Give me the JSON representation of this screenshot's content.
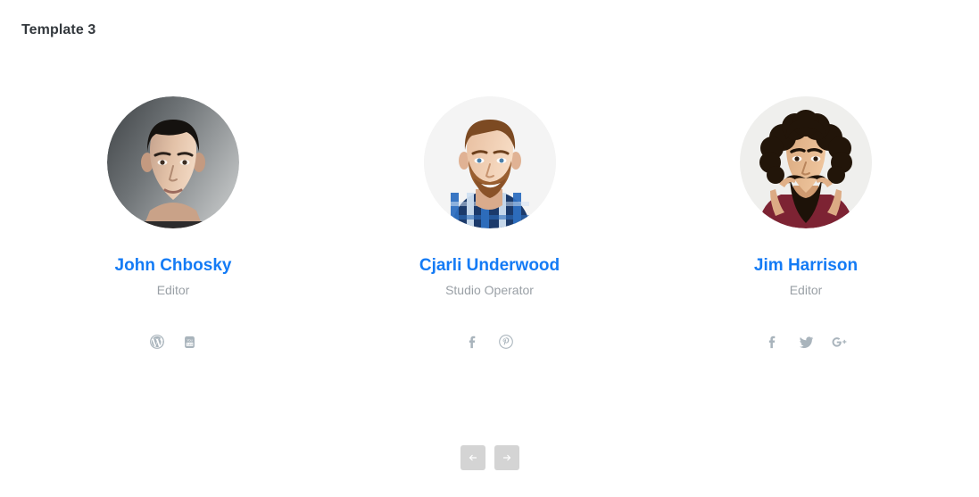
{
  "page": {
    "title": "Template 3",
    "background_color": "#ffffff"
  },
  "theme": {
    "name_color": "#147bf5",
    "role_color": "#9aa0a6",
    "social_icon_color": "#a9b4bc",
    "nav_button_color": "#d4d4d4",
    "nav_arrow_color": "#ffffff",
    "title_color": "#33383d"
  },
  "team": {
    "members": [
      {
        "name": "John Chbosky",
        "role": "Editor",
        "avatar_alt": "Portrait of a young man with short dark hair on a gray gradient background",
        "socials": [
          {
            "label": "WordPress",
            "icon": "wordpress-icon"
          },
          {
            "label": "YouTube",
            "icon": "youtube-icon"
          }
        ]
      },
      {
        "name": "Cjarli Underwood",
        "role": "Studio Operator",
        "avatar_alt": "Portrait of a smiling bearded man in a blue plaid shirt on a white background",
        "socials": [
          {
            "label": "Facebook",
            "icon": "facebook-icon"
          },
          {
            "label": "Pinterest",
            "icon": "pinterest-icon"
          }
        ]
      },
      {
        "name": "Jim Harrison",
        "role": "Editor",
        "avatar_alt": "Portrait of a man with curly hair twirling his long beard and mustache, wearing a maroon shirt",
        "socials": [
          {
            "label": "Facebook",
            "icon": "facebook-icon"
          },
          {
            "label": "Twitter",
            "icon": "twitter-icon"
          },
          {
            "label": "Google Plus",
            "icon": "google-plus-icon"
          }
        ]
      }
    ]
  },
  "carousel": {
    "prev_label": "Previous",
    "next_label": "Next",
    "prev_icon": "arrow-left-icon",
    "next_icon": "arrow-right-icon"
  }
}
